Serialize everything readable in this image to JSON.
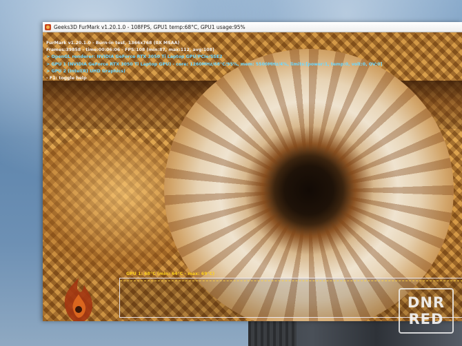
{
  "window": {
    "title": "Geeks3D FurMark v1.20.1.0 - 108FPS, GPU1 temp:68°C, GPU1 usage:95%"
  },
  "overlay": {
    "lines": [
      "FurMark v1.20.1.0 - Burn-in test, 1366x768 (0X MSAA)",
      "Frames:39858 - time:00:06:06 - FPS:108 (min:87, max:112, avg:108)",
      "> OpenGL renderer: NVIDIA GeForce RTX 3050 Ti Laptop GPU/PCIe/SSE2",
      "> GPU 1 (NVIDIA GeForce RTX 3050 Ti Laptop GPU) - core: 1260MHz/68°C/95%, mem: 5500MHz/4%, limits:[power:1, temp:0, volt:0, OV:0]",
      "> GPU 2 (Intel(R) UHD Graphics)",
      "- F1: toggle help"
    ]
  },
  "graph": {
    "label": "GPU 1: 68°C (min: 64°C - max: 69°C)"
  },
  "logo": {
    "text": "FurMark"
  },
  "watermark": {
    "line1": "DNR",
    "line2": "RED"
  },
  "colors": {
    "overlay_white": "#f3f3f3",
    "overlay_yellow": "#ffd21e",
    "overlay_cyan": "#6fd9ff"
  }
}
